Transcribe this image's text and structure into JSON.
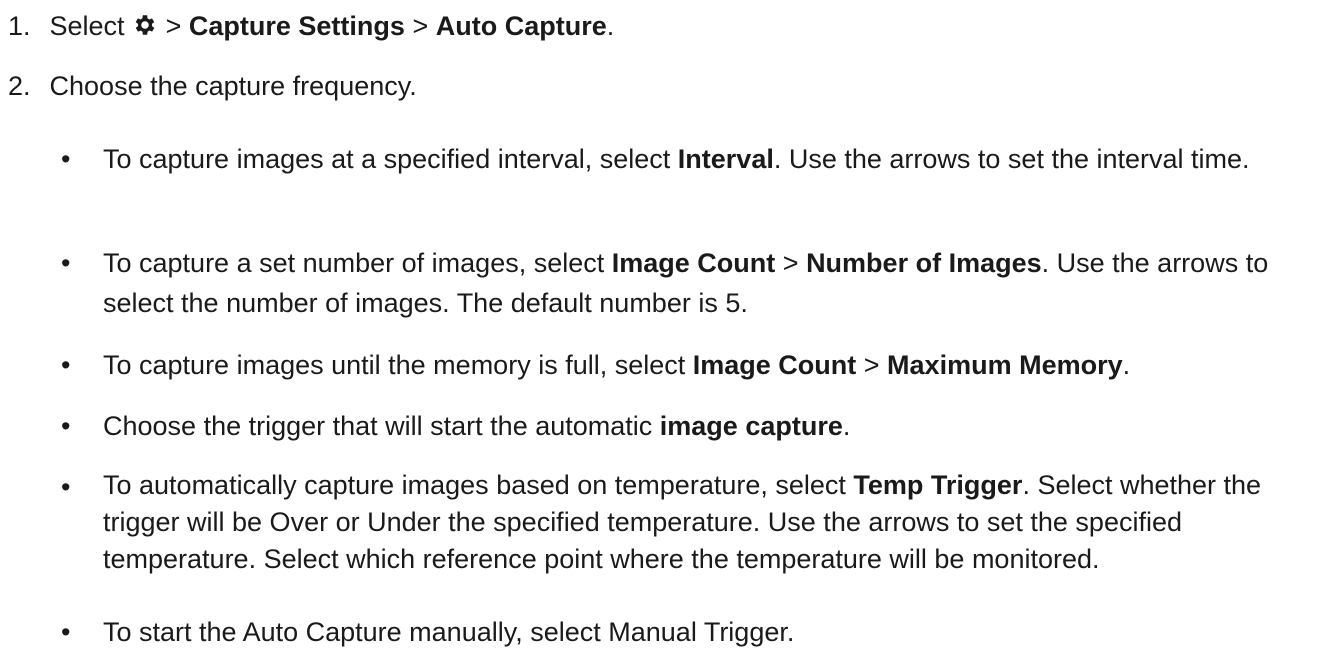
{
  "steps": [
    {
      "number": "1.",
      "select_label": "Select",
      "icon": "gear-icon",
      "sep1": ">",
      "path1": "Capture Settings",
      "sep2": ">",
      "path2": "Auto Capture",
      "end": "."
    },
    {
      "number": "2.",
      "text": "Choose the capture frequency."
    }
  ],
  "bullets": [
    {
      "pre": "To capture images at a specified interval, select ",
      "bold1": "Interval",
      "post": ". Use the arrows to set the interval time."
    },
    {
      "pre": "To capture a set number of images, select ",
      "bold1": "Image Count",
      "mid": " > ",
      "bold2": "Number of Images",
      "post": ". Use the arrows to select the number of images. The default number is 5."
    },
    {
      "pre": "To capture images until the memory is full, select ",
      "bold1": "Image Count",
      "mid": " > ",
      "bold2": "Maximum Memory",
      "post": "."
    },
    {
      "pre": "Choose the trigger that will start the automatic ",
      "bold1": "image capture",
      "post": "."
    },
    {
      "pre": "To automatically capture images based on temperature, select ",
      "bold1": "Temp Trigger",
      "post": ". Select whether the trigger will be Over or Under the specified temperature. Use the arrows to set the specified temperature. Select which reference point where the temperature will be monitored."
    },
    {
      "text": "To start the Auto Capture manually, select Manual Trigger."
    }
  ],
  "bullet_char": "•"
}
